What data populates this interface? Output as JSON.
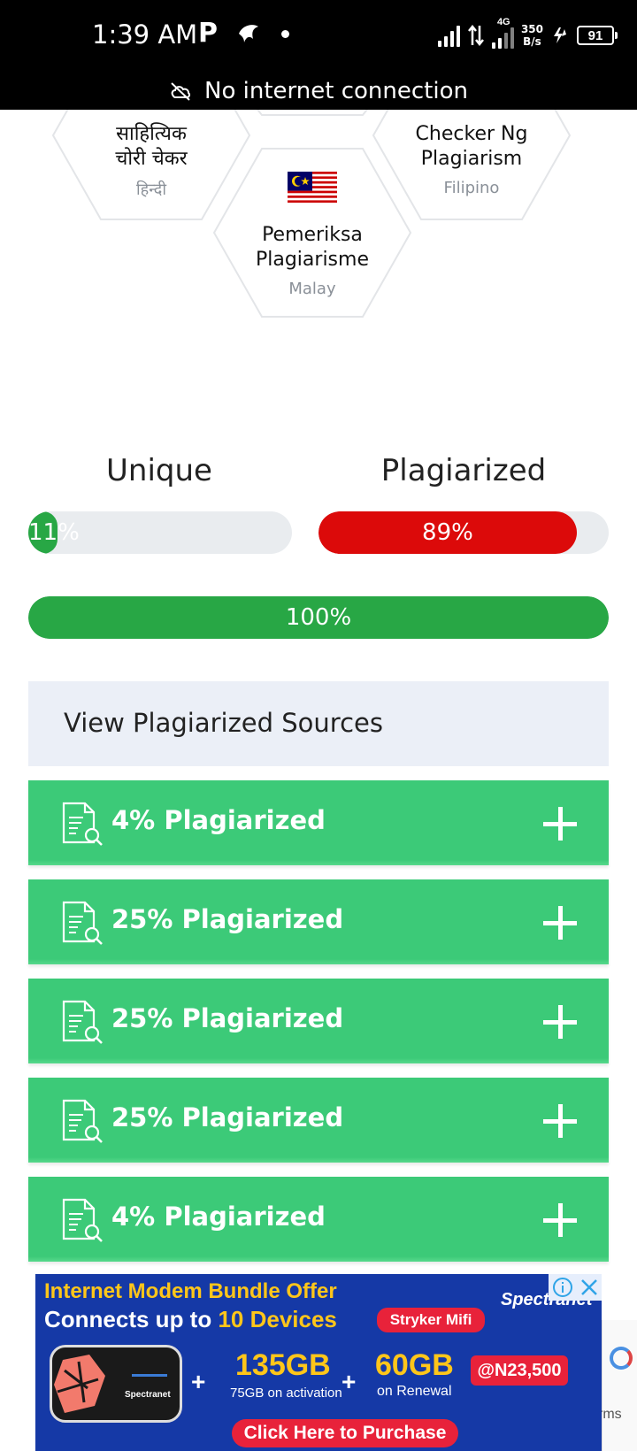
{
  "status_bar": {
    "time": "1:39 AM",
    "p_icon": "P",
    "network_type": "4G",
    "net_speed_value": "350",
    "net_speed_unit": "B/s",
    "battery": "91"
  },
  "connectivity_banner": {
    "text": "No internet connection",
    "icon": "cloud-off-icon"
  },
  "languages": [
    {
      "title_line1": "साहित्यिक",
      "title_line2": "चोरी चेकर",
      "language": "हिन्दी"
    },
    {
      "title_line1": "Checker Ng",
      "title_line2": "Plagiarism",
      "language": "Filipino"
    },
    {
      "title_line1": "Pemeriksa",
      "title_line2": "Plagiarisme",
      "language": "Malay",
      "flag": "malaysia-flag"
    }
  ],
  "stats": {
    "unique": {
      "heading": "Unique",
      "label": "11%",
      "value": 11,
      "color": "#28a745"
    },
    "plagiarized": {
      "heading": "Plagiarized",
      "label": "89%",
      "value": 89,
      "color": "#dc0a0a"
    },
    "overall": {
      "label": "100%",
      "value": 100,
      "color": "#28a745"
    }
  },
  "sources": {
    "title": "View Plagiarized Sources",
    "items": [
      {
        "label": "4% Plagiarized"
      },
      {
        "label": "25% Plagiarized"
      },
      {
        "label": "25% Plagiarized"
      },
      {
        "label": "25% Plagiarized"
      },
      {
        "label": "4% Plagiarized"
      }
    ],
    "row_color": "#3cca78"
  },
  "ad": {
    "headline": "Internet Modem Bundle Offer",
    "subline_prefix": "Connects up to ",
    "subline_highlight": "10 Devices",
    "product_badge": "Stryker Mifi",
    "brand": "Spectranet",
    "data1": "135GB",
    "data1_note": "75GB on activation",
    "data2": "60GB",
    "data2_note": "on Renewal",
    "price": "@N23,500",
    "cta": "Click Here to Purchase",
    "device_brand": "Spectranet",
    "partial_text": "rms"
  }
}
